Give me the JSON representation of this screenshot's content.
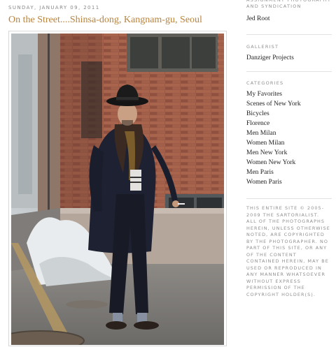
{
  "post": {
    "date": "SUNDAY, JANUARY 09, 2011",
    "title": "On the Street....Shinsa-dong, Kangnam-gu, Seoul"
  },
  "sidebar": {
    "assignment": {
      "heading": "ASSIGNMENT PHOTOGRAPHY AND SYNDICATION",
      "link": "Jed Root"
    },
    "gallerist": {
      "heading": "GALLERIST",
      "link": "Danziger Projects"
    },
    "categories": {
      "heading": "CATEGORIES",
      "items": [
        "My Favorites",
        "Scenes of New York",
        "Bicycles",
        "Florence",
        "Men Milan",
        "Women Milan",
        "Men New York",
        "Women New York",
        "Men Paris",
        "Women Paris"
      ]
    },
    "copyright": "THIS ENTIRE SITE © 2005-2009 THE SARTORIALIST. ALL OF THE PHOTOGRAPHS HEREIN, UNLESS OTHERWISE NOTED, ARE COPYRIGHTED BY THE PHOTOGRAPHER. NO PART OF THIS SITE, OR ANY OF THE CONTENT CONTAINED HEREIN, MAY BE USED OR REPRODUCED IN ANY MANNER WHATSOEVER WITHOUT EXPRESS PERMISSION OF THE COPYRIGHT HOLDER(S)."
  },
  "colors": {
    "title": "#b8833c",
    "meta": "#8f8f8f",
    "link": "#222222"
  }
}
